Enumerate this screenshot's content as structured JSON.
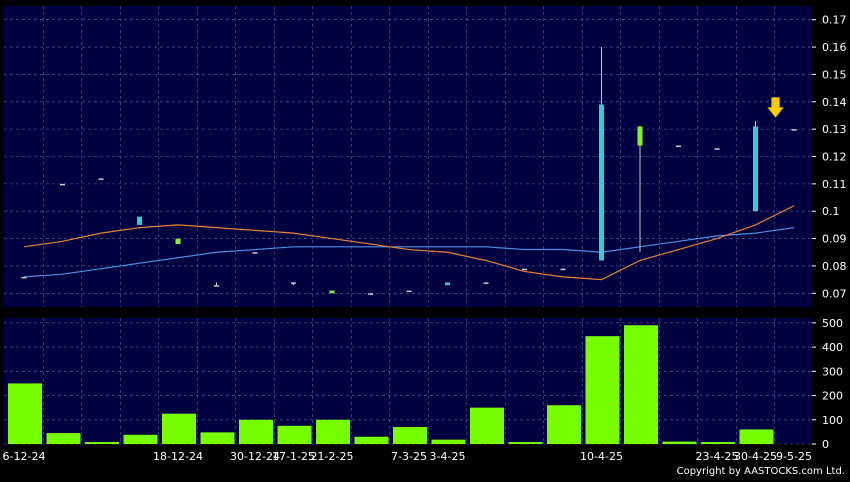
{
  "chart_data": [
    {
      "type": "candlestick",
      "title": "",
      "ylim": [
        0.065,
        0.175
      ],
      "y_ticks": [
        "0.07",
        "0.08",
        "0.09",
        "0.1",
        "0.11",
        "0.12",
        "0.13",
        "0.14",
        "0.15",
        "0.16",
        "0.17"
      ],
      "grid": true,
      "colors": {
        "background": "#000040",
        "grid": "#5a6aa0",
        "up": "#33ccdd",
        "down": "#88ee33",
        "flat": "#cccccc",
        "ma_short": "#e8803a",
        "ma_long": "#4a90e0",
        "marker": "#ffcc00"
      },
      "candles": [
        {
          "open": 0.076,
          "high": 0.076,
          "low": 0.076,
          "close": 0.076
        },
        {
          "open": 0.11,
          "high": 0.11,
          "low": 0.11,
          "close": 0.11
        },
        {
          "open": 0.112,
          "high": 0.112,
          "low": 0.112,
          "close": 0.112
        },
        {
          "open": 0.095,
          "high": 0.098,
          "low": 0.095,
          "close": 0.098
        },
        {
          "open": 0.09,
          "high": 0.09,
          "low": 0.088,
          "close": 0.088
        },
        {
          "open": 0.073,
          "high": 0.074,
          "low": 0.073,
          "close": 0.073
        },
        {
          "open": 0.085,
          "high": 0.085,
          "low": 0.085,
          "close": 0.085
        },
        {
          "open": 0.074,
          "high": 0.074,
          "low": 0.073,
          "close": 0.074
        },
        {
          "open": 0.071,
          "high": 0.071,
          "low": 0.07,
          "close": 0.07
        },
        {
          "open": 0.07,
          "high": 0.07,
          "low": 0.07,
          "close": 0.07
        },
        {
          "open": 0.071,
          "high": 0.071,
          "low": 0.071,
          "close": 0.071
        },
        {
          "open": 0.073,
          "high": 0.074,
          "low": 0.073,
          "close": 0.074
        },
        {
          "open": 0.074,
          "high": 0.074,
          "low": 0.074,
          "close": 0.074
        },
        {
          "open": 0.079,
          "high": 0.079,
          "low": 0.079,
          "close": 0.079
        },
        {
          "open": 0.079,
          "high": 0.079,
          "low": 0.079,
          "close": 0.079
        },
        {
          "open": 0.082,
          "high": 0.16,
          "low": 0.082,
          "close": 0.139
        },
        {
          "open": 0.131,
          "high": 0.131,
          "low": 0.085,
          "close": 0.124
        },
        {
          "open": 0.124,
          "high": 0.124,
          "low": 0.124,
          "close": 0.124
        },
        {
          "open": 0.123,
          "high": 0.123,
          "low": 0.123,
          "close": 0.123
        },
        {
          "open": 0.1,
          "high": 0.133,
          "low": 0.1,
          "close": 0.131
        },
        {
          "open": 0.13,
          "high": 0.13,
          "low": 0.13,
          "close": 0.13
        }
      ],
      "ma_short": [
        0.087,
        0.089,
        0.092,
        0.094,
        0.095,
        0.094,
        0.093,
        0.092,
        0.09,
        0.088,
        0.086,
        0.085,
        0.082,
        0.078,
        0.076,
        0.075,
        0.082,
        0.086,
        0.09,
        0.095,
        0.102
      ],
      "ma_long": [
        0.076,
        0.077,
        0.079,
        0.081,
        0.083,
        0.085,
        0.086,
        0.087,
        0.087,
        0.087,
        0.087,
        0.087,
        0.087,
        0.086,
        0.086,
        0.085,
        0.087,
        0.089,
        0.091,
        0.092,
        0.094
      ],
      "marker": {
        "index": 19,
        "value": 0.135
      }
    },
    {
      "type": "bar",
      "ylim": [
        0,
        520
      ],
      "y_ticks": [
        "0",
        "100",
        "200",
        "300",
        "400",
        "500"
      ],
      "values": [
        250,
        45,
        8,
        38,
        125,
        48,
        100,
        75,
        100,
        30,
        70,
        18,
        150,
        8,
        160,
        445,
        490,
        10,
        8,
        60,
        0
      ],
      "x_labels": [
        {
          "index": 0,
          "label": "6-12-24"
        },
        {
          "index": 4,
          "label": "18-12-24"
        },
        {
          "index": 6,
          "label": "30-12-24"
        },
        {
          "index": 7,
          "label": "17-1-25"
        },
        {
          "index": 8,
          "label": "21-2-25"
        },
        {
          "index": 10,
          "label": "7-3-25"
        },
        {
          "index": 11,
          "label": "3-4-25"
        },
        {
          "index": 15,
          "label": "10-4-25"
        },
        {
          "index": 18,
          "label": "23-4-25"
        },
        {
          "index": 19,
          "label": "30-4-25"
        },
        {
          "index": 20,
          "label": "9-5-25"
        }
      ],
      "bar_color": "#77ff00"
    }
  ],
  "copyright": "Copyright by AASTOCKS.com Ltd."
}
